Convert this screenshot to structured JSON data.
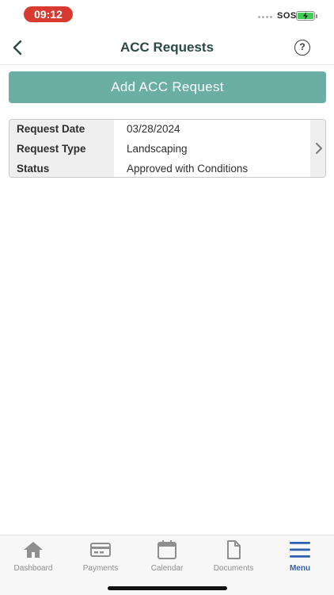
{
  "status_bar": {
    "time": "09:12",
    "carrier": "SOS",
    "time_pill_color": "#d83a2f",
    "battery_color": "#3ecf52",
    "battery_state": "charging"
  },
  "header": {
    "title": "ACC Requests",
    "back_icon": "chevron-left-icon",
    "help_icon": "question-circle-icon",
    "help_label": "?"
  },
  "actions": {
    "add_label": "Add ACC Request",
    "add_color": "#6aaea4"
  },
  "requests": [
    {
      "date_label": "Request Date",
      "date_value": "03/28/2024",
      "type_label": "Request Type",
      "type_value": "Landscaping",
      "status_label": "Status",
      "status_value": "Approved with Conditions"
    }
  ],
  "tab_bar": {
    "tabs": [
      {
        "label": "Dashboard",
        "icon": "home-icon"
      },
      {
        "label": "Payments",
        "icon": "credit-card-icon"
      },
      {
        "label": "Calendar",
        "icon": "calendar-icon"
      },
      {
        "label": "Documents",
        "icon": "document-icon"
      },
      {
        "label": "Menu",
        "icon": "hamburger-menu-icon"
      }
    ],
    "active_color": "#2f5fb0",
    "inactive_color": "#8e8e8e"
  }
}
